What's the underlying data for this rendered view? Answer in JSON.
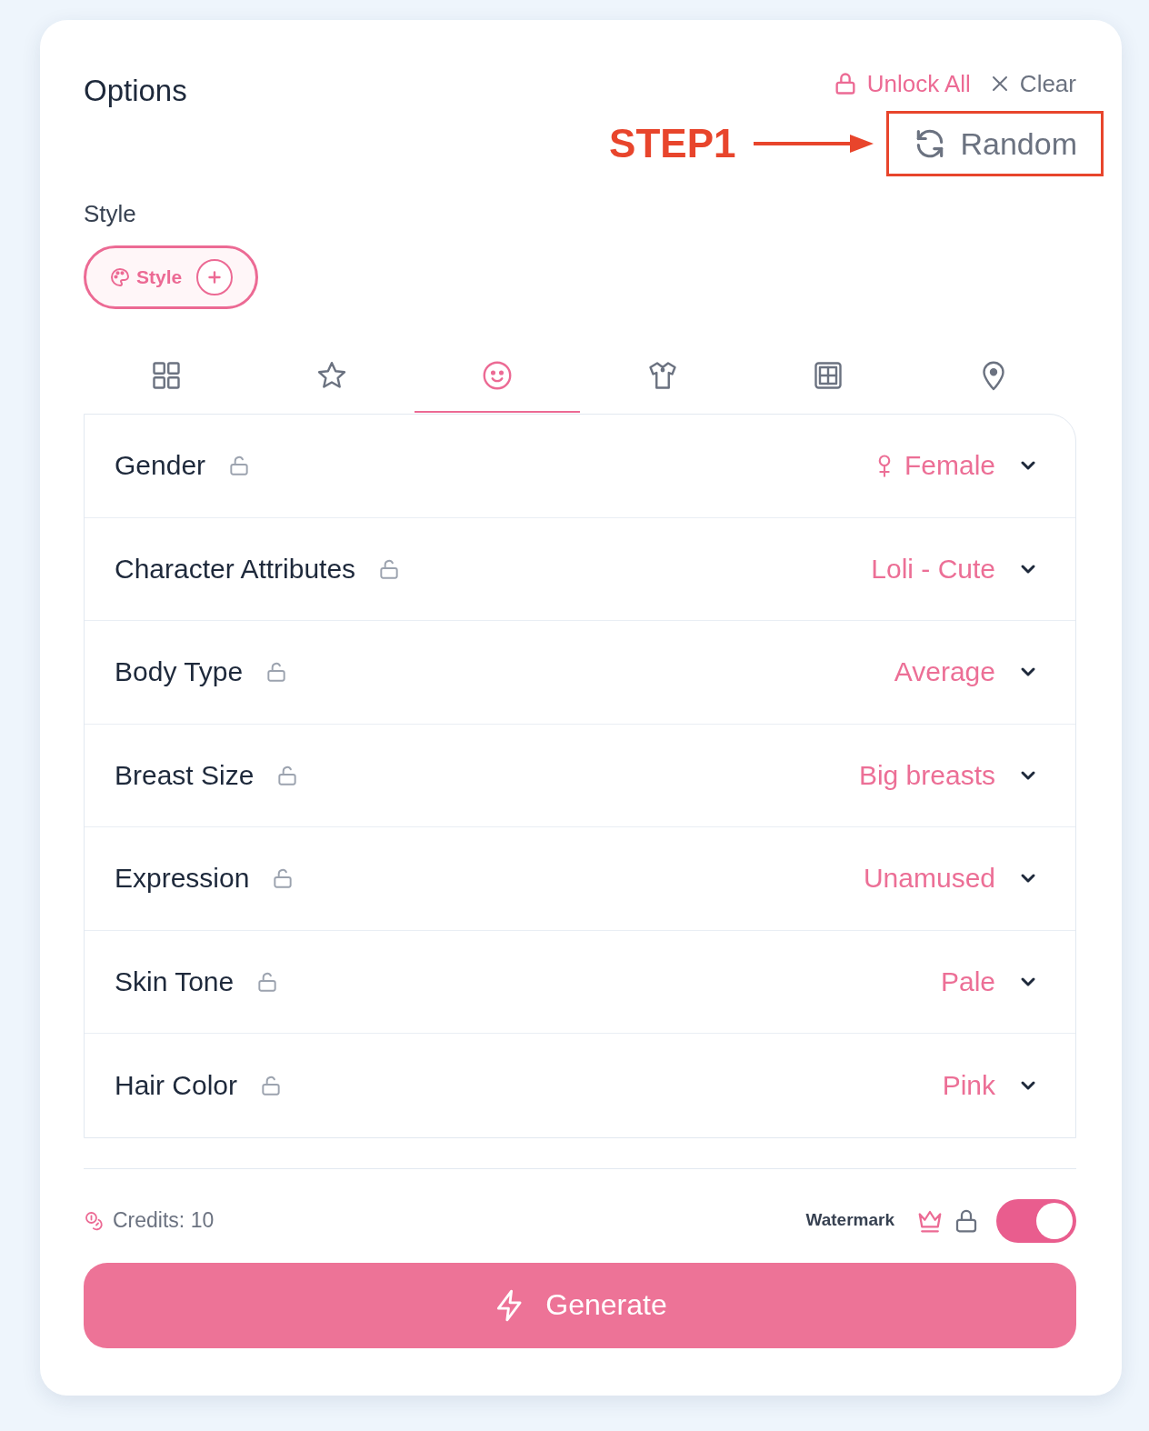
{
  "panel": {
    "title": "Options"
  },
  "header_actions": [
    {
      "kind": "unlock",
      "label": "Unlock All"
    },
    {
      "kind": "clear",
      "label": "Clear"
    }
  ],
  "annotation": {
    "label": "STEP1"
  },
  "random_button": {
    "label": "Random",
    "highlighted": true
  },
  "style_section": {
    "label": "Style",
    "chip": {
      "label": "Style"
    }
  },
  "tabs": [
    {
      "kind": "grid",
      "selected": false
    },
    {
      "kind": "star",
      "selected": false
    },
    {
      "kind": "face",
      "selected": true
    },
    {
      "kind": "shirt",
      "selected": false
    },
    {
      "kind": "frame",
      "selected": false
    },
    {
      "kind": "pin",
      "selected": false
    }
  ],
  "attributes": [
    {
      "kind": "gender",
      "label": "Gender",
      "locked": false,
      "value": "Female"
    },
    {
      "kind": "plain",
      "label": "Character Attributes",
      "locked": false,
      "value": "Loli - Cute"
    },
    {
      "kind": "plain",
      "label": "Body Type",
      "locked": false,
      "value": "Average"
    },
    {
      "kind": "plain",
      "label": "Breast Size",
      "locked": false,
      "value": "Big breasts"
    },
    {
      "kind": "plain",
      "label": "Expression",
      "locked": false,
      "value": "Unamused"
    },
    {
      "kind": "plain",
      "label": "Skin Tone",
      "locked": false,
      "value": "Pale"
    },
    {
      "kind": "plain",
      "label": "Hair Color",
      "locked": false,
      "value": "Pink"
    }
  ],
  "footer": {
    "credits": "Credits: 10",
    "watermark": {
      "label": "Watermark",
      "on": true
    }
  },
  "generate_button": {
    "label": "Generate"
  }
}
